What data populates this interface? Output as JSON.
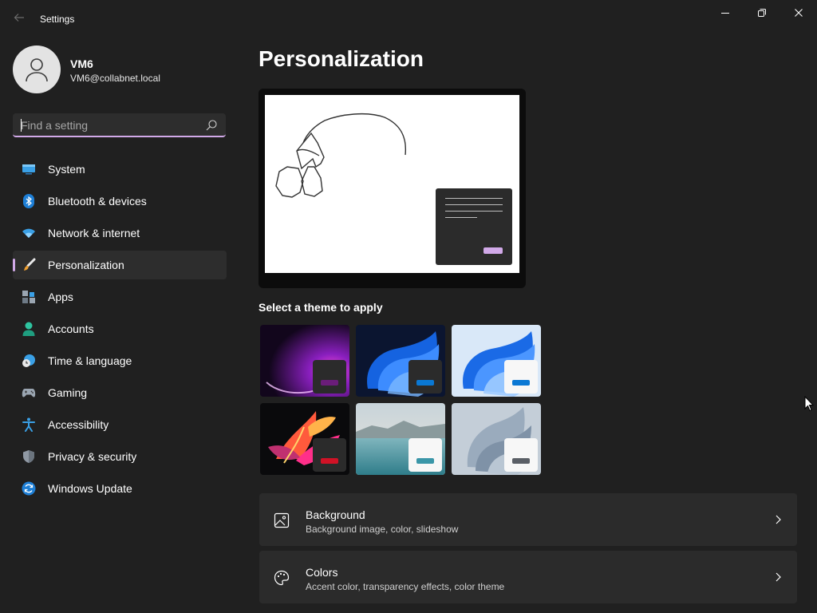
{
  "window": {
    "title": "Settings"
  },
  "profile": {
    "name": "VM6",
    "email": "VM6@collabnet.local"
  },
  "search": {
    "placeholder": "Find a setting"
  },
  "nav": {
    "items": [
      {
        "label": "System",
        "icon": "system-icon"
      },
      {
        "label": "Bluetooth & devices",
        "icon": "bluetooth-icon"
      },
      {
        "label": "Network & internet",
        "icon": "wifi-icon"
      },
      {
        "label": "Personalization",
        "icon": "brush-icon",
        "active": true
      },
      {
        "label": "Apps",
        "icon": "apps-icon"
      },
      {
        "label": "Accounts",
        "icon": "accounts-icon"
      },
      {
        "label": "Time & language",
        "icon": "clock-globe-icon"
      },
      {
        "label": "Gaming",
        "icon": "gamepad-icon"
      },
      {
        "label": "Accessibility",
        "icon": "accessibility-icon"
      },
      {
        "label": "Privacy & security",
        "icon": "shield-icon"
      },
      {
        "label": "Windows Update",
        "icon": "update-icon"
      }
    ]
  },
  "main": {
    "title": "Personalization",
    "themes_heading": "Select a theme to apply",
    "themes": [
      {
        "name": "glow",
        "window": "dark",
        "accent": "#6b1d7a"
      },
      {
        "name": "windows-dark",
        "window": "dark",
        "accent": "#0a78d4"
      },
      {
        "name": "windows-light",
        "window": "light",
        "accent": "#0a78d4"
      },
      {
        "name": "captured-motion",
        "window": "dark",
        "accent": "#d01226"
      },
      {
        "name": "sunrise",
        "window": "light",
        "accent": "#3a96a8"
      },
      {
        "name": "flow",
        "window": "light",
        "accent": "#5a5f66"
      }
    ],
    "cards": [
      {
        "title": "Background",
        "subtitle": "Background image, color, slideshow",
        "icon": "image-icon"
      },
      {
        "title": "Colors",
        "subtitle": "Accent color, transparency effects, color theme",
        "icon": "palette-icon"
      }
    ]
  },
  "colors": {
    "accent": "#d1a9e8",
    "background": "#202020",
    "card": "#2b2b2b"
  }
}
